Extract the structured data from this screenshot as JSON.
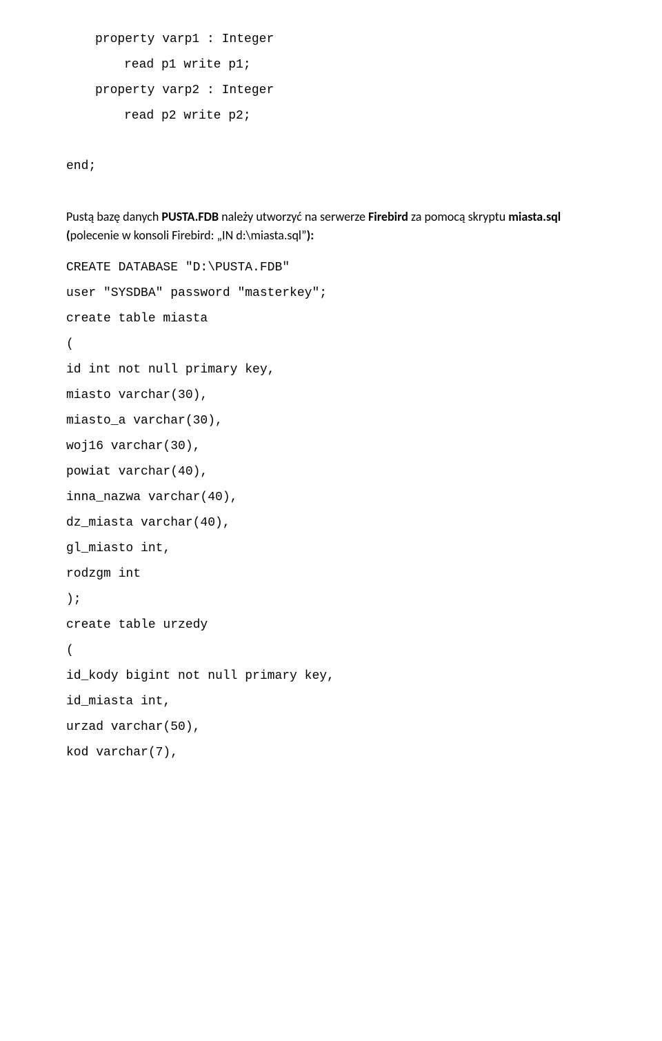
{
  "lines": {
    "prop_varp1": "property varp1 : Integer",
    "read_p1": "read p1 write p1;",
    "prop_varp2": "property varp2 : Integer",
    "read_p2": "read p2 write p2;",
    "end": "end;"
  },
  "para1": {
    "t1": "Pustą bazę danych ",
    "b1": "PUSTA.FDB",
    "t2": " należy utworzyć na serwerze ",
    "b2": "Firebird",
    "t3": " za pomocą skryptu ",
    "b3": "miasta.sql",
    "t4": " (",
    "t5": "polecenie w konsoli Firebird: „IN d:\\miasta.sql”",
    "t6": "):"
  },
  "sql": {
    "l1": "CREATE DATABASE \"D:\\PUSTA.FDB\"",
    "l2": "user \"SYSDBA\" password \"masterkey\";",
    "l3": "create table miasta",
    "l4": "(",
    "l5": "id int not null primary key,",
    "l6": "miasto varchar(30),",
    "l7": "miasto_a varchar(30),",
    "l8": "woj16 varchar(30),",
    "l9": "powiat varchar(40),",
    "l10": "inna_nazwa varchar(40),",
    "l11": "dz_miasta varchar(40),",
    "l12": "gl_miasto int,",
    "l13": "rodzgm int",
    "l14": ");",
    "l15": "create table urzedy",
    "l16": "(",
    "l17": "id_kody bigint not null primary key,",
    "l18": "id_miasta int,",
    "l19": "urzad varchar(50),",
    "l20": "kod varchar(7),"
  }
}
